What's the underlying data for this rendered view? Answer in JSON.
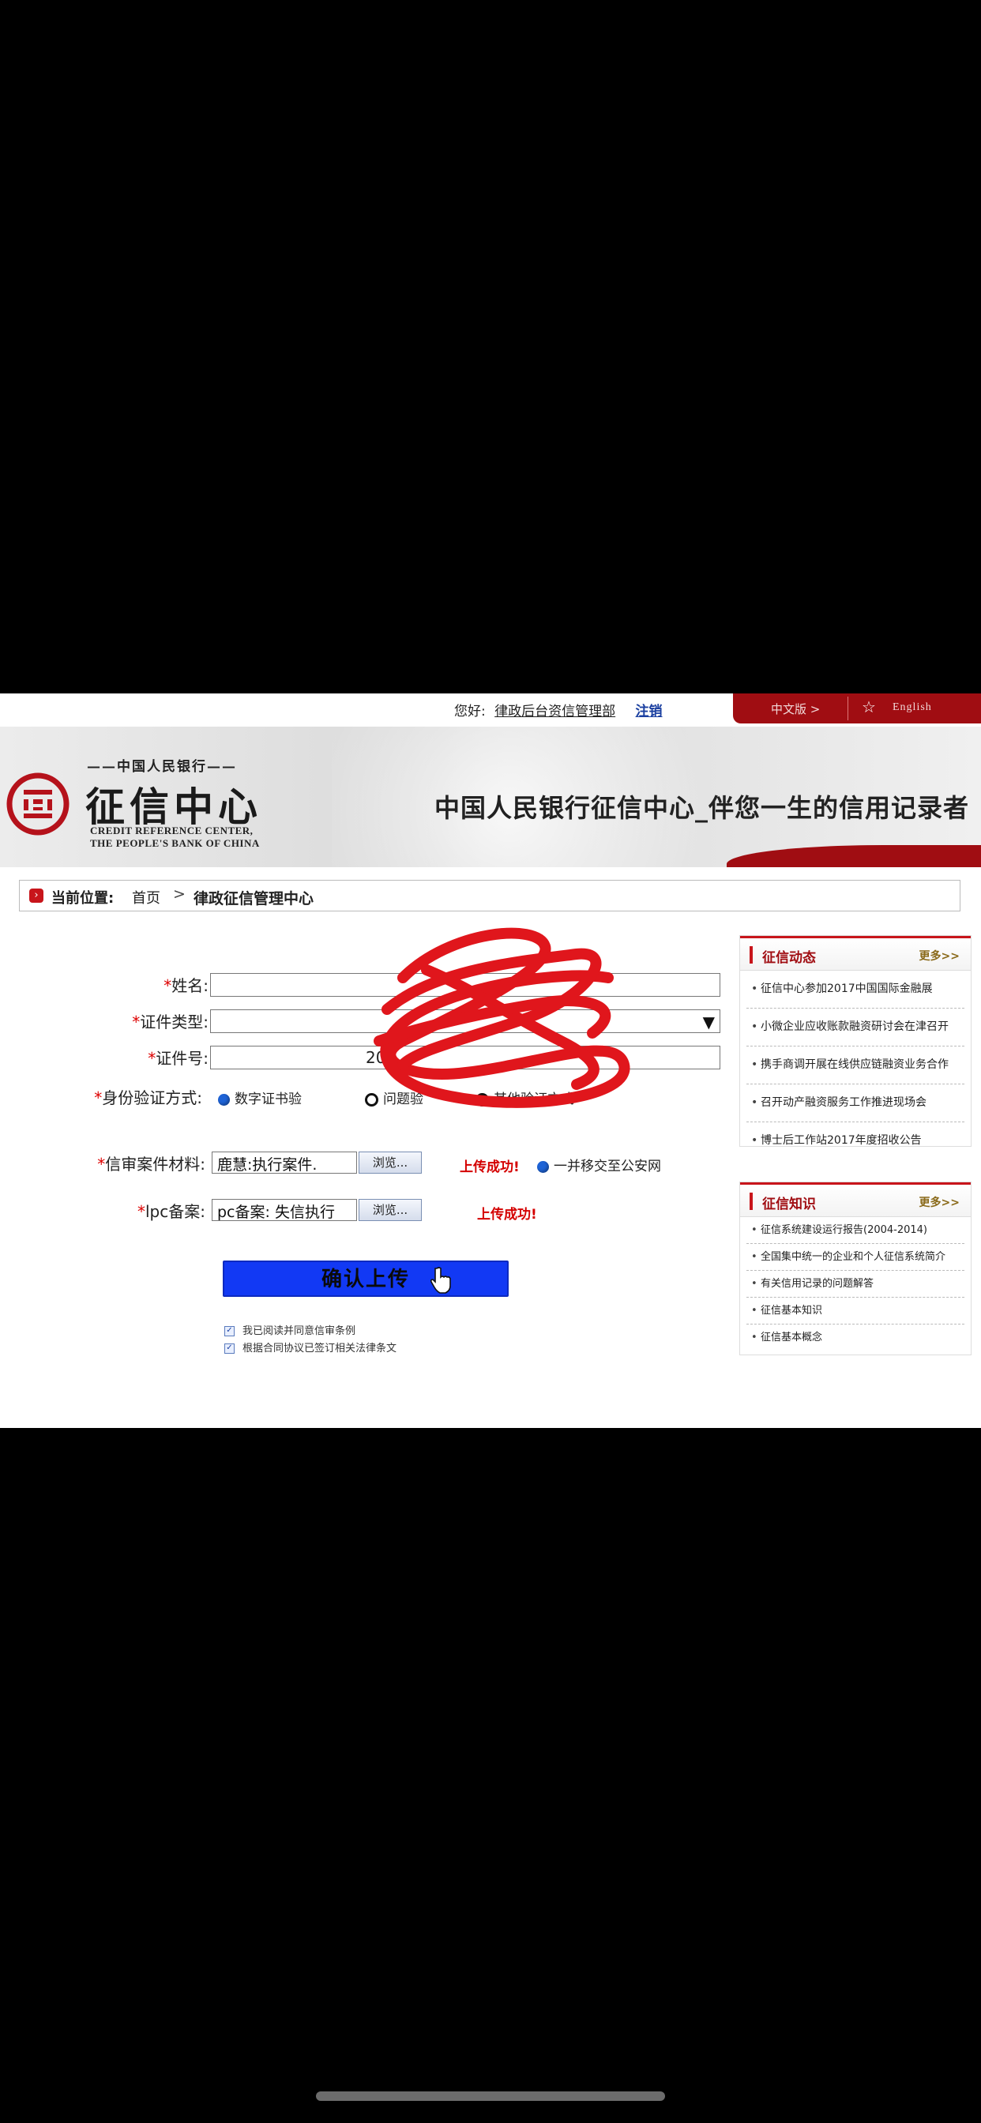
{
  "header": {
    "logo_small_text": "中国人民银行",
    "logo_main_text": "征信中心",
    "logo_en_line1": "CREDIT REFERENCE CENTER,",
    "logo_en_line2": "THE PEOPLE'S BANK OF CHINA",
    "slogan": "中国人民银行征信中心_伴您一生的信用记录者",
    "greeting": "您好:",
    "user_name": "律政后台资信管理部",
    "logout": "注销",
    "lang_zh": "中文版 >",
    "lang_en": "English"
  },
  "breadcrumb": {
    "label": "当前位置:",
    "home": "首页",
    "current": "律政征信管理中心"
  },
  "form": {
    "name_label": "姓名:",
    "name_value": "",
    "id_type_label": "证件类型:",
    "id_type_value": "",
    "id_number_label": "证件号:",
    "id_number_value": "203",
    "auth_label": "身份验证方式:",
    "auth_options": [
      "数字证书验",
      "问题验",
      "其他验证方式"
    ],
    "material_label": "信审案件材料:",
    "material_file": "鹿慧:执行案件.",
    "material_browse": "浏览...",
    "material_status": "上传成功!",
    "material_option": "一并移交至公安网",
    "ipc_label": "lpc备案:",
    "ipc_file": "pc备案: 失信执行",
    "ipc_browse": "浏览...",
    "ipc_status": "上传成功!",
    "submit": "确认上传",
    "agree1": "我已阅读并同意信审条例",
    "agree2": "根据合同协议已签订相关法律条文"
  },
  "news": {
    "title": "征信动态",
    "more": "更多>>",
    "items": [
      "征信中心参加2017中国国际金融展",
      "小微企业应收账款融资研讨会在津召开",
      "携手商调开展在线供应链融资业务合作",
      "召开动产融资服务工作推进现场会",
      "博士后工作站2017年度招收公告"
    ]
  },
  "knowledge": {
    "title": "征信知识",
    "more": "更多>>",
    "items": [
      "征信系统建设运行报告(2004-2014)",
      "全国集中统一的企业和个人征信系统简介",
      "有关信用记录的问题解答",
      "征信基本知识",
      "征信基本概念"
    ]
  },
  "colors": {
    "brand_red": "#a00d12",
    "submit_blue": "#1239f4",
    "success_red": "#d40000"
  }
}
